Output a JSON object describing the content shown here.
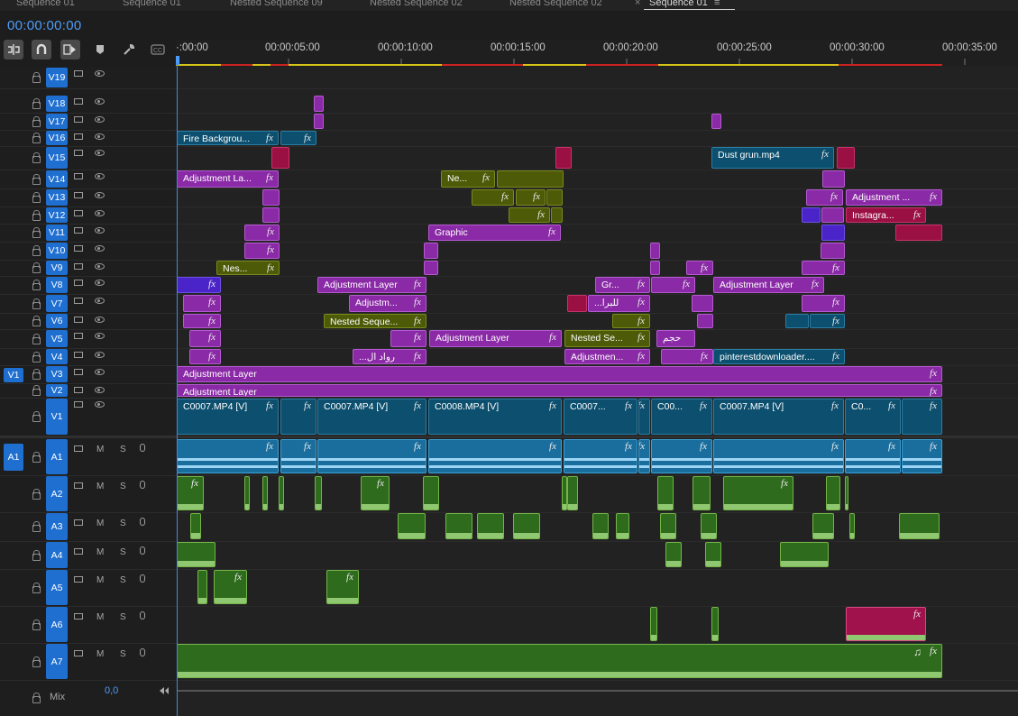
{
  "tabs": [
    {
      "label": "Sequence 01"
    },
    {
      "label": "Sequence 01"
    },
    {
      "label": "Nested Sequence 09"
    },
    {
      "label": "Nested Sequence 02"
    },
    {
      "label": "Nested Sequence 02"
    },
    {
      "label": "Sequence 01",
      "active": true
    }
  ],
  "tab_close": "×",
  "tab_menu": "≡",
  "timecode": "00:00:00:00",
  "toolbar": {
    "icons": [
      "insert-overwrite-icon",
      "snap-magnet-icon",
      "linked-selection-icon",
      "marker-icon",
      "wrench-icon",
      "captions-icon"
    ]
  },
  "ruler": [
    "·:00:00",
    "00:00:05:00",
    "00:00:10:00",
    "00:00:15:00",
    "00:00:20:00",
    "00:00:25:00",
    "00:00:30:00",
    "00:00:35:00"
  ],
  "video_tracks": [
    "V19",
    "V18",
    "V17",
    "V16",
    "V15",
    "V14",
    "V13",
    "V12",
    "V11",
    "V10",
    "V9",
    "V8",
    "V7",
    "V6",
    "V5",
    "V4",
    "V3",
    "V2",
    "V1"
  ],
  "audio_tracks": [
    "A1",
    "A2",
    "A3",
    "A4",
    "A5",
    "A6",
    "A7"
  ],
  "source_video": "V1",
  "source_audio": "A1",
  "mute_label": "M",
  "solo_label": "S",
  "mix": {
    "label": "Mix",
    "value": "0,0"
  },
  "clips": {
    "fire": "Fire Backgrou...",
    "dust": "Dust grun.mp4",
    "adj_la": "Adjustment La...",
    "ne": "Ne...",
    "adjustment_dots": "Adjustment ...",
    "instagra": "Instagra...",
    "graphic": "Graphic",
    "nes": "Nes...",
    "adj_layer": "Adjustment Layer",
    "gr": "Gr...",
    "adjustm": "Adjustm...",
    "arabic1": "...للبرا",
    "nested_seq": "Nested Seque...",
    "nested_se": "Nested Se...",
    "arabic2": "حجم",
    "arabic3": "...رواد ال",
    "adjustmen": "Adjustmen...",
    "pinterest": "pinterestdownloader....",
    "c0007": "C0007.MP4 [V]",
    "c0008": "C0008.MP4 [V]",
    "c0007s": "C0007...",
    "c00": "C00...",
    "c0": "C0...",
    "fx": "fx",
    "music_note": "♫",
    "sparkle": "✷"
  },
  "colors": {
    "accent": "#4d9cf8",
    "badge": "#1f6fd1",
    "adjustment": "#8a2aa6",
    "video": "#0c4f6e",
    "nested": "#4d5a07",
    "audio_clip": "#1a6e9d",
    "audio_green": "#2e6b1d"
  }
}
